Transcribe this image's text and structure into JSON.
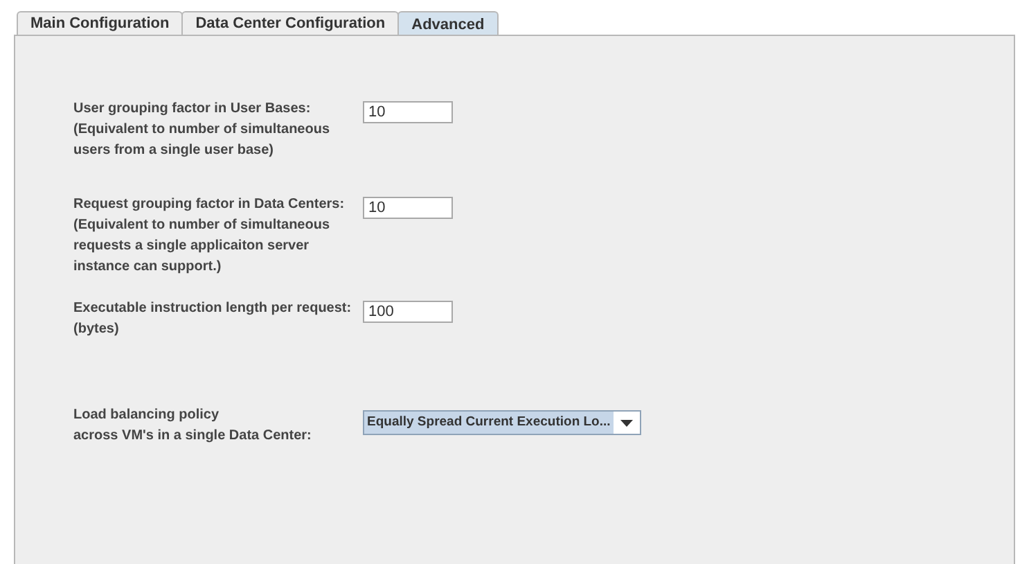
{
  "tabs": [
    {
      "label": "Main Configuration",
      "selected": false
    },
    {
      "label": "Data Center Configuration",
      "selected": false
    },
    {
      "label": "Advanced",
      "selected": true
    }
  ],
  "settings": [
    {
      "kind": "text",
      "label_lines": [
        "User grouping factor in User Bases:",
        "(Equivalent to number of simultaneous",
        "users from a single user base)"
      ],
      "value": "10"
    },
    {
      "kind": "text",
      "label_lines": [
        "Request grouping factor in Data Centers:",
        "(Equivalent to number of simultaneous",
        "requests a single applicaiton server",
        "instance can support.)"
      ],
      "value": "10"
    },
    {
      "kind": "text",
      "label_lines": [
        "Executable instruction length per request:",
        "(bytes)"
      ],
      "value": "100"
    },
    {
      "kind": "dropdown",
      "label_lines": [
        "Load balancing policy",
        "across VM's in a single Data Center:"
      ],
      "value": "Equally Spread Current Execution Lo..."
    }
  ]
}
